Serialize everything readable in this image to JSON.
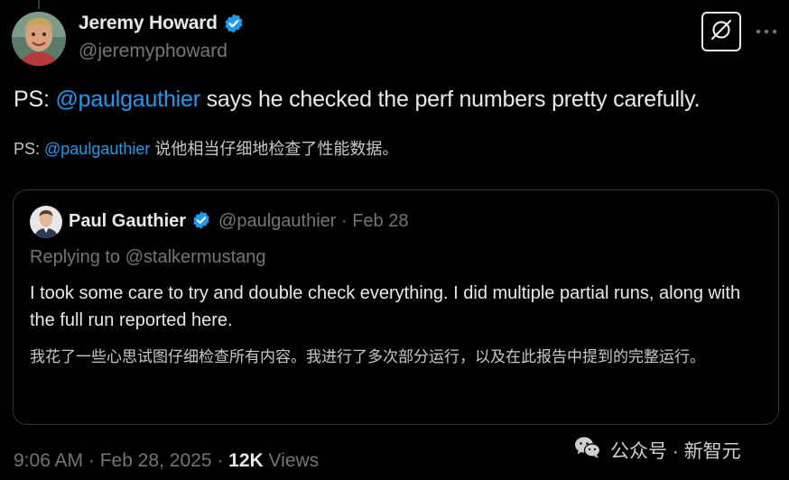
{
  "author": {
    "display_name": "Jeremy Howard",
    "handle": "@jeremyphoward"
  },
  "post": {
    "prefix": "PS: ",
    "mention": "@paulgauthier",
    "rest": " says he checked the perf numbers pretty carefully.",
    "translation_prefix": "PS: ",
    "translation_mention": "@paulgauthier",
    "translation_rest": " 说他相当仔细地检查了性能数据。"
  },
  "quote": {
    "display_name": "Paul Gauthier",
    "handle": "@paulgauthier",
    "separator": " · ",
    "date": "Feb 28",
    "replying_to": "Replying to @stalkermustang",
    "text": "I took some care to try and double check everything. I did multiple partial runs, along with the full run reported here.",
    "translation": "我花了一些心思试图仔细检查所有内容。我进行了多次部分运行，以及在此报告中提到的完整运行。"
  },
  "footer": {
    "time": "9:06 AM",
    "sep1": " · ",
    "date": "Feb 28, 2025",
    "sep2": " · ",
    "views_count": "12K",
    "views_label": " Views"
  },
  "watermark": {
    "text": "公众号 · 新智元"
  },
  "icons": {
    "verified": "verified-badge-icon",
    "grok": "grok-icon",
    "more": "more-icon",
    "wechat": "wechat-icon"
  },
  "colors": {
    "accent": "#1d9bf0",
    "background": "#000000",
    "text": "#e7e9ea",
    "muted": "#71767b"
  }
}
